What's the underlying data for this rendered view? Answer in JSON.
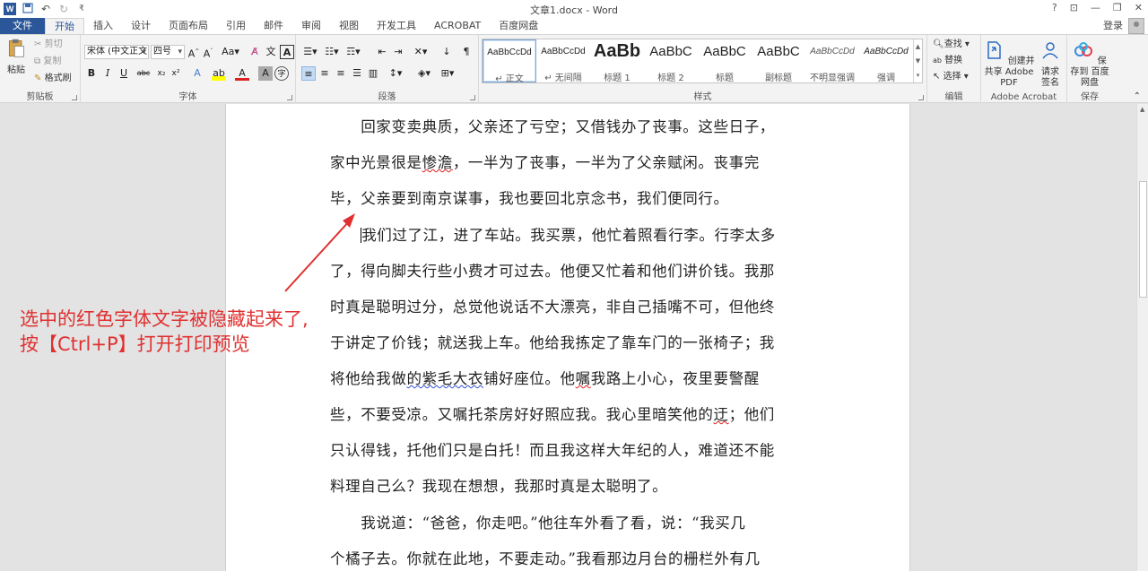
{
  "window": {
    "title": "文章1.docx - Word",
    "controls": [
      "?",
      "⊡",
      "—",
      "❐",
      "✕"
    ]
  },
  "tabs": {
    "file": "文件",
    "items": [
      "开始",
      "插入",
      "设计",
      "页面布局",
      "引用",
      "邮件",
      "审阅",
      "视图",
      "开发工具",
      "ACROBAT",
      "百度网盘"
    ],
    "login": "登录"
  },
  "ribbon": {
    "clipboard": {
      "label": "剪贴板",
      "paste": "粘贴",
      "cut": "剪切",
      "copy": "复制",
      "format_painter": "格式刷"
    },
    "font": {
      "label": "字体",
      "font_name": "宋体 (中文正文",
      "font_size": "四号"
    },
    "paragraph": {
      "label": "段落"
    },
    "styles": {
      "label": "样式",
      "items": [
        {
          "sample": "AaBbCcDd",
          "name": "↵ 正文"
        },
        {
          "sample": "AaBbCcDd",
          "name": "↵ 无间隔"
        },
        {
          "sample": "AaBb",
          "name": "标题 1"
        },
        {
          "sample": "AaBbC",
          "name": "标题 2"
        },
        {
          "sample": "AaBbC",
          "name": "标题"
        },
        {
          "sample": "AaBbC",
          "name": "副标题"
        },
        {
          "sample": "AaBbCcDd",
          "name": "不明显强调"
        },
        {
          "sample": "AaBbCcDd",
          "name": "强调"
        }
      ]
    },
    "editing": {
      "label": "编辑",
      "find": "查找",
      "replace": "替换",
      "select": "选择"
    },
    "acrobat": {
      "label": "Adobe Acrobat",
      "create_pdf": "创建并共享 Adobe PDF",
      "request_sign": "请求 签名"
    },
    "save": {
      "label": "保存",
      "baidu": "保存到 百度网盘"
    }
  },
  "document": {
    "lines": [
      "　　回家变卖典质，父亲还了亏空；又借钱办了丧事。这些日子，",
      "家中光景很是惨澹，一半为了丧事，一半为了父亲赋闲。丧事完",
      "毕，父亲要到南京谋事，我也要回北京念书，我们便同行。",
      "　　我们过了江，进了车站。我买票，他忙着照看行李。行李太多",
      "了，得向脚夫行些小费才可过去。他便又忙着和他们讲价钱。我那",
      "时真是聪明过分，总觉他说话不大漂亮，非自己插嘴不可，但他终",
      "于讲定了价钱；就送我上车。他给我拣定了靠车门的一张椅子；我",
      "将他给我做的紫毛大衣铺好座位。他嘱我路上小心，夜里要警醒",
      "些，不要受凉。又嘱托茶房好好照应我。我心里暗笑他的迂；他们",
      "只认得钱，托他们只是白托！而且我这样大年纪的人，难道还不能",
      "料理自己么？我现在想想，我那时真是太聪明了。",
      "　　我说道：“爸爸，你走吧。”他往车外看了看，说：“我买几",
      "个橘子去。你就在此地，不要走动。”我看那边月台的栅栏外有几"
    ]
  },
  "annotation": {
    "line1": "选中的红色字体文字被隐藏起来了,",
    "line2": "按【Ctrl+P】打开打印预览",
    "color": "#e03030"
  }
}
